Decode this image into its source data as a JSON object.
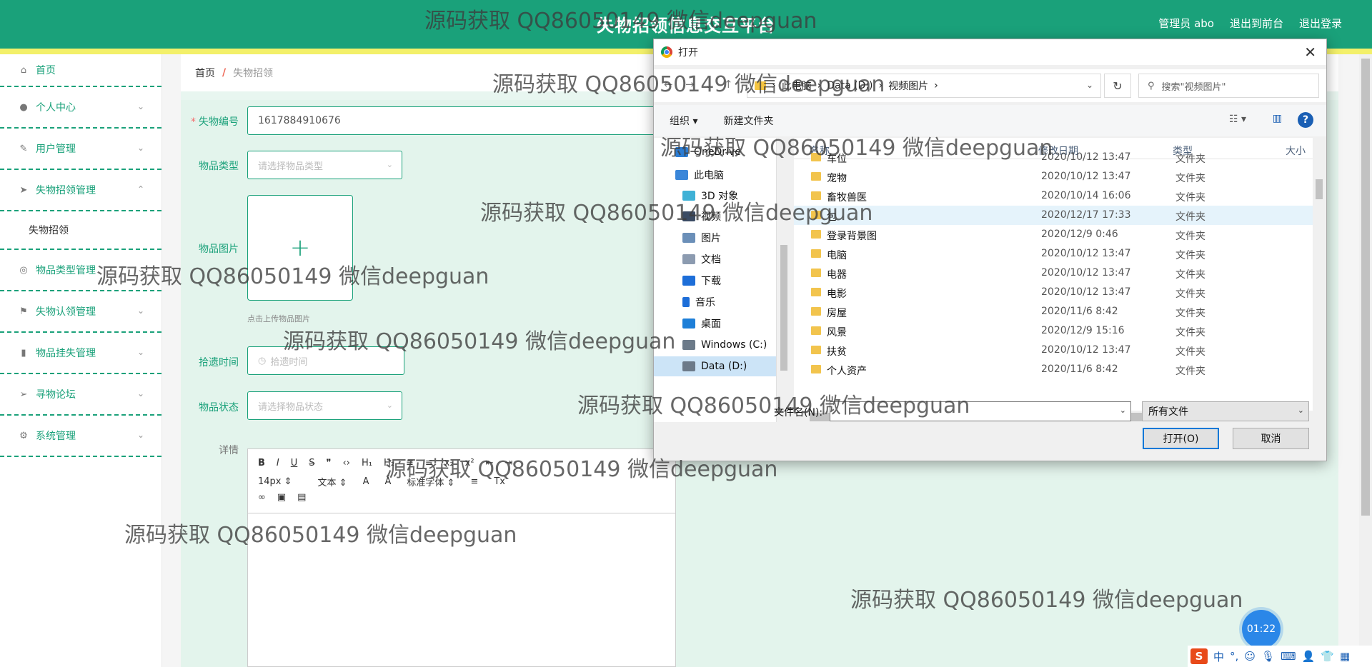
{
  "header": {
    "title": "失物招领信息交互平台",
    "admin_label": "管理员 abo",
    "back_front": "退出到前台",
    "logout": "退出登录"
  },
  "sidebar": {
    "items": [
      {
        "label": "首页",
        "icon": "home-icon"
      },
      {
        "label": "个人中心",
        "icon": "user-icon"
      },
      {
        "label": "用户管理",
        "icon": "edit-icon"
      },
      {
        "label": "失物招领管理",
        "icon": "send-icon"
      },
      {
        "label": "失物招领",
        "icon": ""
      },
      {
        "label": "物品类型管理",
        "icon": "compass-icon"
      },
      {
        "label": "失物认领管理",
        "icon": "flag-icon"
      },
      {
        "label": "物品挂失管理",
        "icon": "bar-chart-icon"
      },
      {
        "label": "寻物论坛",
        "icon": "send-icon"
      },
      {
        "label": "系统管理",
        "icon": "settings-icon"
      }
    ]
  },
  "breadcrumb": {
    "home": "首页",
    "separator": "/",
    "current": "失物招领"
  },
  "form": {
    "lost_no_label": "失物编号",
    "lost_no_value": "1617884910676",
    "type_label": "物品类型",
    "type_placeholder": "请选择物品类型",
    "image_label": "物品图片",
    "upload_hint": "点击上传物品图片",
    "time_label": "拾遗时间",
    "time_placeholder": "拾遗时间",
    "status_label": "物品状态",
    "status_placeholder": "请选择物品状态",
    "detail_label": "详情"
  },
  "editor": {
    "row1": [
      "B",
      "I",
      "U",
      "S",
      "❞",
      "‹›",
      "H₁",
      "H₂",
      "≡",
      "≡",
      "x₂",
      "x²",
      "⇤",
      "⇥"
    ],
    "font_size": "14px",
    "text_style": "文本",
    "font_family": "标准字体"
  },
  "dialog": {
    "title": "打开",
    "path": [
      "此电脑",
      "Data (D:)",
      "视频图片"
    ],
    "search_placeholder": "搜索\"视频图片\"",
    "organize": "组织",
    "new_folder": "新建文件夹",
    "nav": [
      {
        "label": "OneDrive",
        "color": "#2b7cd3"
      },
      {
        "label": "此电脑",
        "color": "#3a86d9"
      },
      {
        "label": "3D 对象",
        "color": "#3fb1d6"
      },
      {
        "label": "视频",
        "color": "#3b4b63"
      },
      {
        "label": "图片",
        "color": "#6b8fb8"
      },
      {
        "label": "文档",
        "color": "#8c9bb0"
      },
      {
        "label": "下载",
        "color": "#1d6ed8"
      },
      {
        "label": "音乐",
        "color": "#1d6ed8"
      },
      {
        "label": "桌面",
        "color": "#1e7fd8"
      },
      {
        "label": "Windows (C:)",
        "color": "#6c7a89"
      },
      {
        "label": "Data (D:)",
        "color": "#6c7a89"
      }
    ],
    "columns": {
      "name": "名称",
      "date": "修改日期",
      "type": "类型",
      "size": "大小"
    },
    "files": [
      {
        "name": "车位",
        "date": "2020/10/12 13:47",
        "type": "文件夹"
      },
      {
        "name": "宠物",
        "date": "2020/10/12 13:47",
        "type": "文件夹"
      },
      {
        "name": "畜牧兽医",
        "date": "2020/10/14 16:06",
        "type": "文件夹"
      },
      {
        "name": "包",
        "date": "2020/12/17 17:33",
        "type": "文件夹"
      },
      {
        "name": "登录背景图",
        "date": "2020/12/9 0:46",
        "type": "文件夹"
      },
      {
        "name": "电脑",
        "date": "2020/10/12 13:47",
        "type": "文件夹"
      },
      {
        "name": "电器",
        "date": "2020/10/12 13:47",
        "type": "文件夹"
      },
      {
        "name": "电影",
        "date": "2020/10/12 13:47",
        "type": "文件夹"
      },
      {
        "name": "房屋",
        "date": "2020/11/6 8:42",
        "type": "文件夹"
      },
      {
        "name": "风景",
        "date": "2020/12/9 15:16",
        "type": "文件夹"
      },
      {
        "name": "扶贫",
        "date": "2020/10/12 13:47",
        "type": "文件夹"
      },
      {
        "name": "个人资产",
        "date": "2020/11/6 8:42",
        "type": "文件夹"
      }
    ],
    "filename_label": "文件名(N):",
    "filename_value": "",
    "filter": "所有文件",
    "open_btn": "打开(O)",
    "cancel_btn": "取消"
  },
  "timer": "01:22",
  "ime": {
    "lang": "中",
    "punct": "°,"
  },
  "watermark": "源码获取 QQ86050149 微信deepguan"
}
